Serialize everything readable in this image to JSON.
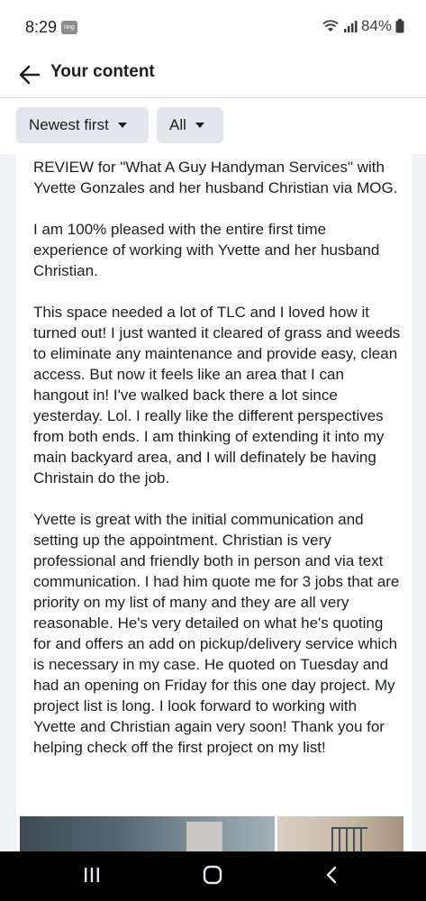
{
  "status_bar": {
    "time": "8:29",
    "notification_badge": "ring",
    "battery": "84%",
    "icons": [
      "wifi-icon",
      "signal-icon",
      "battery-icon"
    ]
  },
  "header": {
    "title": "Your content",
    "back_icon": "arrow-left-icon"
  },
  "filters": {
    "sort_label": "Newest first",
    "type_label": "All"
  },
  "post": {
    "paragraphs": [
      "REVIEW for \"What A Guy Handyman Services\" with Yvette Gonzales and her husband Christian via MOG.",
      "I am 100% pleased with the entire first time experience of working with Yvette and her husband Christian.",
      "This space needed a lot of TLC and I loved how it turned out! I just wanted it cleared of grass and weeds to eliminate any maintenance and provide easy, clean access. But now it feels like an area that I can hangout in! I've walked back there a lot since yesterday. Lol. I really like the different perspectives from both ends. I am thinking of extending it into my main backyard area, and I will definately be having Christain do the job.",
      "Yvette is great with the initial communication and setting up the appointment. Christian is very professional and friendly both in person and via text communication. I had him quote me for 3 jobs that are priority on my list of many and they are all very reasonable. He's very detailed on what he's quoting for and offers an add on pickup/delivery service which is necessary in my case. He quoted on Tuesday and had an opening on Friday for this one day project. My project list is long. I look forward to working with Yvette and Christian again very soon! Thank you for helping check off the first project on my list!"
    ]
  },
  "nav_bar": {
    "icons": [
      "recents-icon",
      "home-icon",
      "back-icon"
    ]
  },
  "colors": {
    "background": "#f0f2f5",
    "card": "#ffffff",
    "chip": "#e4e6eb",
    "text": "#1c1e21",
    "nav_bar": "#000000"
  }
}
